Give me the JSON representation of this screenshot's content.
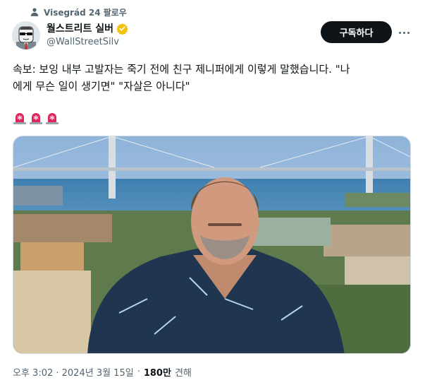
{
  "social_context": {
    "text": "Visegrád 24 팔로우",
    "icon": "person-icon"
  },
  "author": {
    "display_name": "월스트리트 실버",
    "handle": "@WallStreetSilv",
    "verified_color": "#F4C20D"
  },
  "actions": {
    "subscribe_label": "구독하다",
    "more_icon": "more-icon"
  },
  "tweet": {
    "text_line_1": "속보: 보잉 내부 고발자는 죽기 전에 친구 제니퍼에게 이렇게 말했습니다. \"나",
    "text_line_2": "에게 무슨 일이 생기면\" \"자살은 아니다\"",
    "emojis": [
      "police-car-light-icon",
      "police-car-light-icon",
      "police-car-light-icon"
    ]
  },
  "meta": {
    "timestamp": "오후 3:02 · 2024년 3월 15일",
    "separator": "·",
    "views_count": "180만",
    "views_label": "견해"
  },
  "colors": {
    "accent_dark": "#0F1419",
    "secondary_text": "#536471",
    "border": "#CFD9DE",
    "siren_red": "#E0245E"
  }
}
